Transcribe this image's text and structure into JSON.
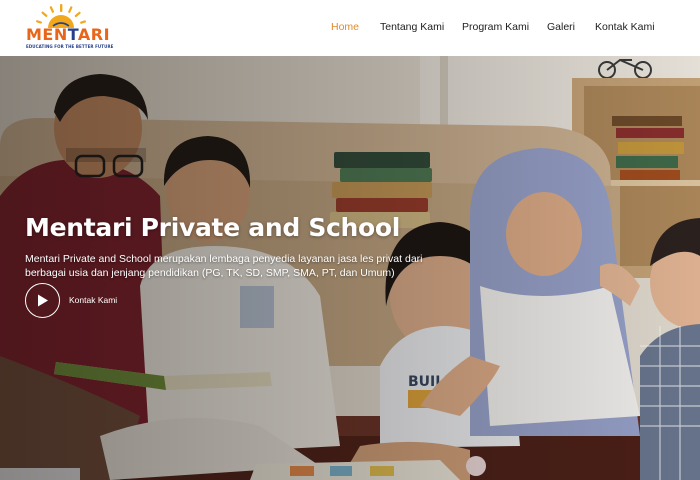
{
  "logo": {
    "name_part1": "MEN",
    "name_part2": "T",
    "name_part3": "ARI",
    "tagline": "EDUCATING FOR THE BETTER FUTURE"
  },
  "nav": {
    "items": [
      {
        "label": "Home",
        "active": true
      },
      {
        "label": "Tentang Kami",
        "active": false
      },
      {
        "label": "Program Kami",
        "active": false
      },
      {
        "label": "Galeri",
        "active": false
      },
      {
        "label": "Kontak Kami",
        "active": false
      }
    ]
  },
  "hero": {
    "title": "Mentari Private and School",
    "description": "Mentari Private and School merupakan lembaga penyedia layanan jasa les privat dari berbagai usia dan jenjang pendidikan (PG, TK, SD, SMP, SMA, PT, dan Umum)",
    "cta_label": "Kontak Kami",
    "cta_icon": "play-icon"
  },
  "colors": {
    "accent": "#e08a2c",
    "logo_orange": "#e8651a",
    "logo_blue": "#27408b"
  }
}
